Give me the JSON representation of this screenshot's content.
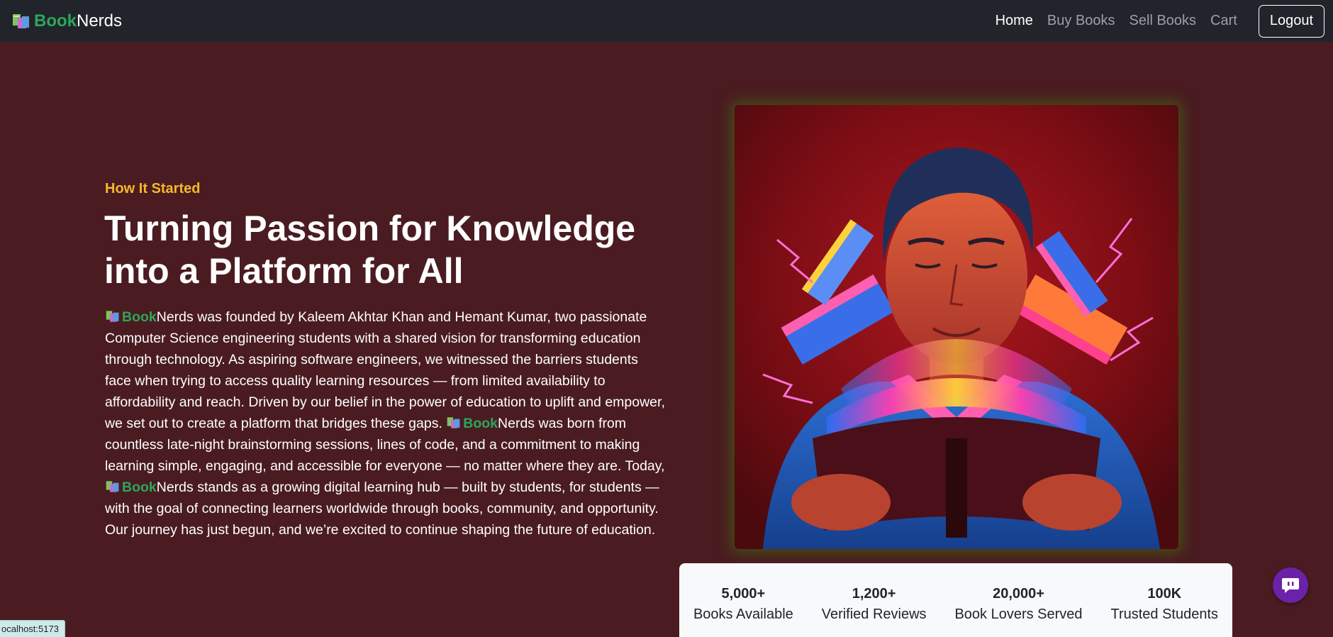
{
  "navbar": {
    "brand_book": "Book",
    "brand_nerds": "Nerds",
    "links": [
      "Home",
      "Buy Books",
      "Sell Books",
      "Cart"
    ],
    "logout_label": "Logout"
  },
  "hero": {
    "eyebrow": "How It Started",
    "title_line1": "Turning Passion for Knowledge",
    "title_line2": "into a Platform for All",
    "brand_book": "Book",
    "brand_nerds": "Nerds",
    "body_part1": " was founded by Kaleem Akhtar Khan and Hemant Kumar, two passionate Computer Science engineering students with a shared vision for transforming education through technology. As aspiring software engineers, we witnessed the barriers students face when trying to access quality learning resources — from limited availability to affordability and reach. Driven by our belief in the power of education to uplift and empower, we set out to create a platform that bridges these gaps. ",
    "body_part2": " was born from countless late-night brainstorming sessions, lines of code, and a commitment to making learning simple, engaging, and accessible for everyone — no matter where they are. Today, ",
    "body_part3": " stands as a growing digital learning hub — built by students, for students — with the goal of connecting learners worldwide through books, community, and opportunity. Our journey has just begun, and we’re excited to continue shaping the future of education."
  },
  "stats": [
    {
      "value": "5,000+",
      "label": "Books Available"
    },
    {
      "value": "1,200+",
      "label": "Verified Reviews"
    },
    {
      "value": "20,000+",
      "label": "Book Lovers Served"
    },
    {
      "value": "100K",
      "label": "Trusted Students"
    }
  ],
  "status_url": "ocalhost:5173",
  "colors": {
    "page_background": "#4a1c21",
    "navbar_background": "#21252b",
    "brand_green": "#2ea55b",
    "eyebrow_yellow": "#f5b82b",
    "chat_purple": "#6b21a8"
  },
  "icons": {
    "brand": "books-logo-icon",
    "chat": "chat-bubble-icon",
    "hero_image": "man-reading-glowing-book-illustration"
  }
}
